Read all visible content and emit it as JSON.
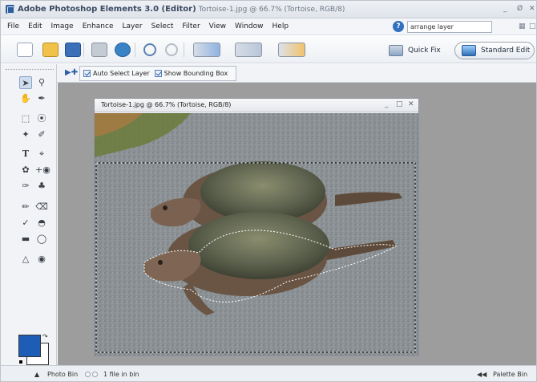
{
  "window": {
    "app_title": "Adobe Photoshop Elements 3.0 (Editor)",
    "doc_title": "Tortoise-1.jpg @ 66.7% (Tortoise, RGB/8)",
    "minimize": "_",
    "restore": "Ø",
    "close": "✕"
  },
  "menu": [
    "File",
    "Edit",
    "Image",
    "Enhance",
    "Layer",
    "Select",
    "Filter",
    "View",
    "Window",
    "Help"
  ],
  "help_search": {
    "value": "arrange layer"
  },
  "modes": {
    "quick_fix": "Quick Fix",
    "standard_edit": "Standard Edit"
  },
  "options": {
    "auto_select": "Auto Select Layer",
    "show_bounding": "Show Bounding Box"
  },
  "document": {
    "title": "Tortoise-1.jpg @ 66.7% (Tortoise, RGB/8)",
    "minimize": "_",
    "maximize": "□",
    "close": "✕"
  },
  "status": {
    "photo_bin": "Photo Bin",
    "files": "1 file in bin",
    "palette_bin": "Palette Bin"
  },
  "colors": {
    "foreground": "#1d5db5",
    "background": "#ffffff",
    "workspace": "#9d9d9d"
  },
  "icons": {
    "toolbox": [
      "move-tool-icon",
      "zoom-tool-icon",
      "hand-tool-icon",
      "eyedropper-tool-icon",
      "marquee-tool-icon",
      "lasso-tool-icon",
      "magic-wand-tool-icon",
      "selection-brush-tool-icon",
      "type-tool-icon",
      "crop-tool-icon",
      "cookie-cutter-tool-icon",
      "red-eye-tool-icon",
      "healing-brush-tool-icon",
      "clone-stamp-tool-icon",
      "pencil-tool-icon",
      "eraser-tool-icon",
      "brush-tool-icon",
      "paint-bucket-tool-icon",
      "gradient-tool-icon",
      "shape-tool-icon",
      "blur-tool-icon",
      "sponge-tool-icon"
    ],
    "shortcuts": [
      "new-icon",
      "open-icon",
      "save-icon",
      "print-icon",
      "online-services-icon",
      "undo-icon",
      "redo-icon",
      "photo-browser-icon",
      "file-browser-icon",
      "create-icon"
    ]
  }
}
